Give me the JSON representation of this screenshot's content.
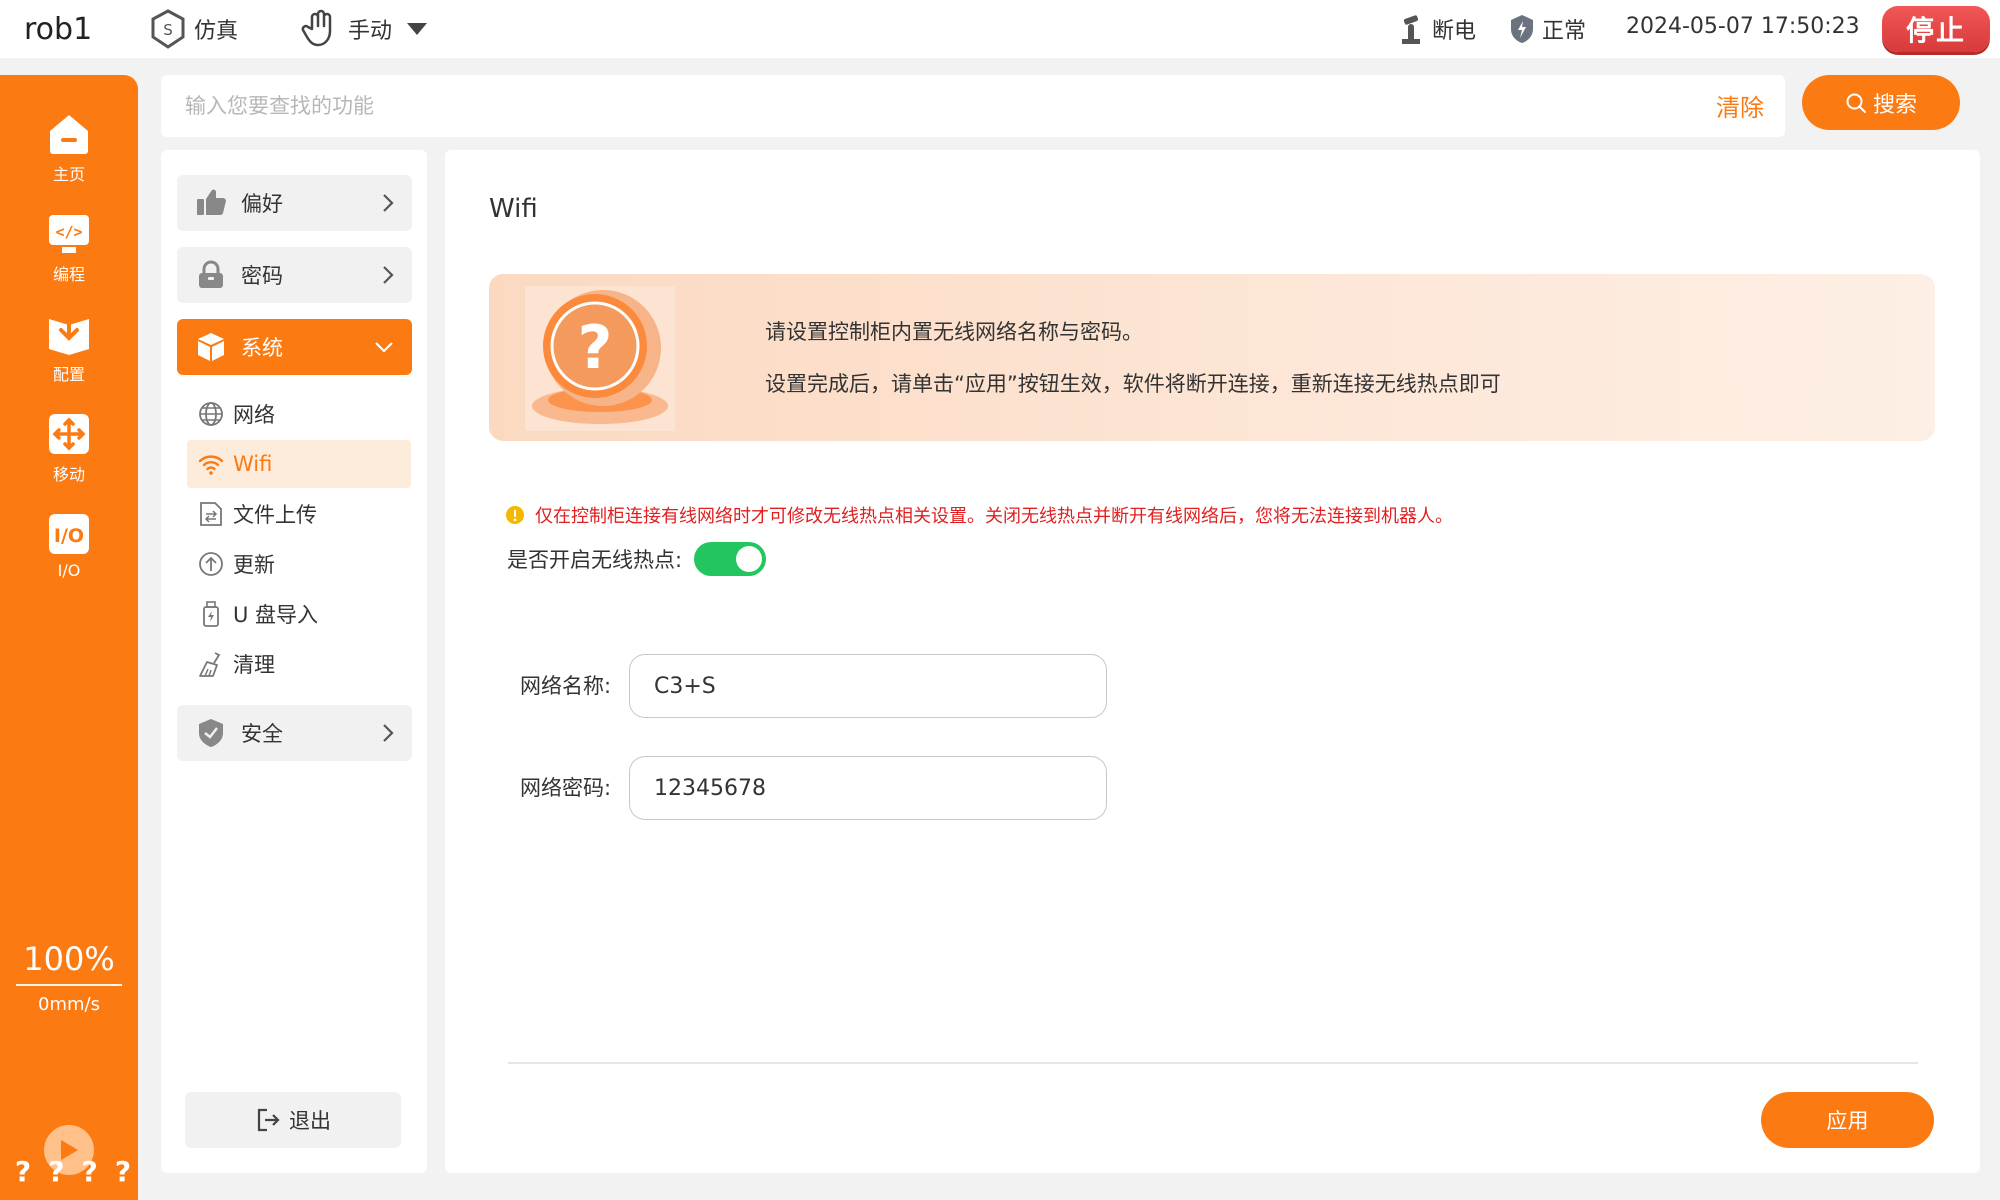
{
  "topbar": {
    "robot_name": "rob1",
    "mode_sim": "仿真",
    "mode_manual": "手动",
    "power_status": "断电",
    "safety_status": "正常",
    "datetime": "2024-05-07 17:50:23",
    "stop_label": "停止"
  },
  "leftnav": {
    "items": [
      {
        "label": "主页",
        "icon": "home-icon"
      },
      {
        "label": "编程",
        "icon": "code-icon"
      },
      {
        "label": "配置",
        "icon": "config-download-icon"
      },
      {
        "label": "移动",
        "icon": "move-arrows-icon"
      },
      {
        "label": "I/O",
        "icon": "io-icon"
      }
    ],
    "speed_percent": "100%",
    "speed_value": "0mm/s",
    "quick_marks": [
      "?",
      "?",
      "?",
      "?"
    ]
  },
  "search": {
    "placeholder": "输入您要查找的功能",
    "value": "",
    "clear_label": "清除",
    "button_label": "搜索"
  },
  "settings_nav": {
    "menu": [
      {
        "label": "偏好",
        "icon": "thumbs-up-icon"
      },
      {
        "label": "密码",
        "icon": "lock-icon"
      },
      {
        "label": "系统",
        "icon": "cube-icon"
      },
      {
        "label": "安全",
        "icon": "shield-icon"
      }
    ],
    "system_sub": [
      {
        "label": "网络",
        "icon": "globe-icon"
      },
      {
        "label": "Wifi",
        "icon": "wifi-icon"
      },
      {
        "label": "文件上传",
        "icon": "file-upload-icon"
      },
      {
        "label": "更新",
        "icon": "update-icon"
      },
      {
        "label": "U 盘导入",
        "icon": "usb-icon"
      },
      {
        "label": "清理",
        "icon": "broom-icon"
      }
    ],
    "logout_label": "退出"
  },
  "main": {
    "title": "Wifi",
    "banner_line1": "请设置控制柜内置无线网络名称与密码。",
    "banner_line2": "设置完成后，请单击“应用”按钮生效，软件将断开连接，重新连接无线热点即可",
    "warning": "仅在控制柜连接有线网络时才可修改无线热点相关设置。关闭无线热点并断开有线网络后，您将无法连接到机器人。",
    "hotspot_label": "是否开启无线热点:",
    "hotspot_on": true,
    "ssid_label": "网络名称:",
    "ssid_value": "C3+S",
    "password_label": "网络密码:",
    "password_value": "12345678",
    "apply_label": "应用"
  },
  "colors": {
    "accent": "#fb7a12",
    "stop": "#e04444",
    "toggle_on": "#22c55e",
    "warning_text": "#e02020"
  }
}
